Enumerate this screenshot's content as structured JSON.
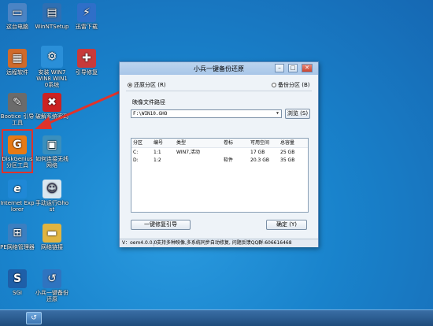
{
  "desktop": {
    "icons": [
      {
        "label": "这台电脑",
        "glyph": "▭",
        "color": "#4b84c4"
      },
      {
        "label": "WinNTSetup",
        "glyph": "▤",
        "color": "#2e6fb3"
      },
      {
        "label": "迅雷下载",
        "glyph": "⚡",
        "color": "#2f6fc8"
      },
      {
        "label": "远程软件",
        "glyph": "▦",
        "color": "#d06a2a"
      },
      {
        "label": "安装 WIN7 WIN8 WIN10系统",
        "glyph": "⚙",
        "color": "#2a8fd8"
      },
      {
        "label": "引导修复",
        "glyph": "✚",
        "color": "#c83a3a"
      },
      {
        "label": "Bootice 引导工具",
        "glyph": "✎",
        "color": "#6b6b6b"
      },
      {
        "label": "破解系统密码",
        "glyph": "✖",
        "color": "#cc2222"
      },
      {
        "label": "DiskGenius 分区工具",
        "glyph": "G",
        "color": "#e87a14"
      },
      {
        "label": "如何连接无线网络",
        "glyph": "▣",
        "color": "#3a8fbd"
      },
      {
        "label": "Internet Explorer",
        "glyph": "e",
        "color": "#1f88d6"
      },
      {
        "label": "手动运行Ghost",
        "glyph": "☺",
        "color": "#d9e6ef"
      },
      {
        "label": "PE网络管理器",
        "glyph": "⊞",
        "color": "#3b7fc1"
      },
      {
        "label": "网络链接",
        "glyph": "▬",
        "color": "#e0b440"
      },
      {
        "label": "SGI",
        "glyph": "S",
        "color": "#1e5fa8"
      },
      {
        "label": "小兵一键备份还原",
        "glyph": "↺",
        "color": "#2f74c0"
      }
    ]
  },
  "dialog": {
    "title": "小兵一键备份还原",
    "minimize": "–",
    "maximize": "□",
    "close": "✕",
    "restore_option": "还原分区 (R)",
    "backup_option": "备份分区 (B)",
    "image_path_label": "映像文件路径",
    "image_path_value": "F:\\WIN10.GHO",
    "browse_button": "浏览 (S)",
    "table": {
      "headers": [
        "分区",
        "编号",
        "类型",
        "卷标",
        "可用空间",
        "总容量"
      ],
      "rows": [
        [
          "C:",
          "1:1",
          "WIN7,活动",
          "",
          "17 GB",
          "25 GB"
        ],
        [
          "D:",
          "1:2",
          "",
          "软件",
          "20.3 GB",
          "35 GB"
        ]
      ]
    },
    "repair_button": "一键修复引导",
    "ok_button": "确定 (Y)",
    "version": "V：oem4.0.0.0",
    "status": "支持多种映像,多系统同步自动修复, 问题反馈QQ群:606616468"
  },
  "taskbar": {
    "app_glyph": "↺"
  },
  "colors": {
    "highlight": "#e0332b",
    "arrow": "#e0332b",
    "desktop": "#1a7fc8"
  }
}
